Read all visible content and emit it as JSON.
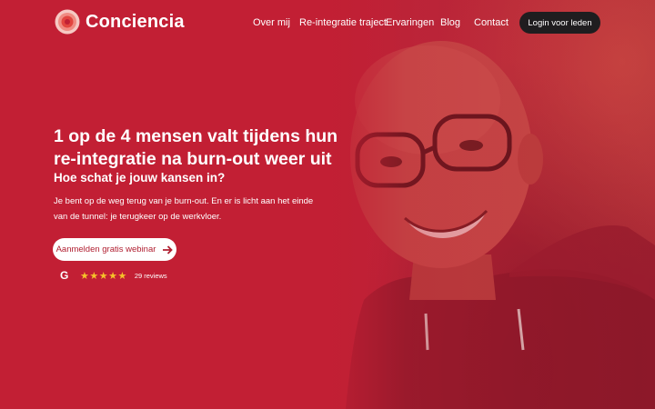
{
  "brand": {
    "name": "Conciencia"
  },
  "nav": {
    "items": [
      "Over mij",
      "Re-integratie traject",
      "Ervaringen",
      "Blog",
      "Contact"
    ],
    "login": "Login voor leden"
  },
  "hero": {
    "headline_1": "1 op de 4 mensen valt tijdens hun",
    "headline_2": "re-integratie na burn-out weer uit",
    "subhead": "Hoe schat je jouw kansen in?",
    "body_1": "Je bent op de weg terug van je burn-out. En er is licht aan het einde",
    "body_2": "van de tunnel: je terugkeer op de werkvloer.",
    "cta": "Aanmelden gratis webinar",
    "cta_icon": "arrow-right-icon"
  },
  "reviews": {
    "source_icon": "google-icon",
    "google_letter": "G",
    "stars": "★★★★★",
    "rating": 5,
    "count_text": "29 reviews"
  },
  "colors": {
    "primary": "#c01f34",
    "button_dark": "#1f1d1f",
    "star": "#f5c22a"
  }
}
